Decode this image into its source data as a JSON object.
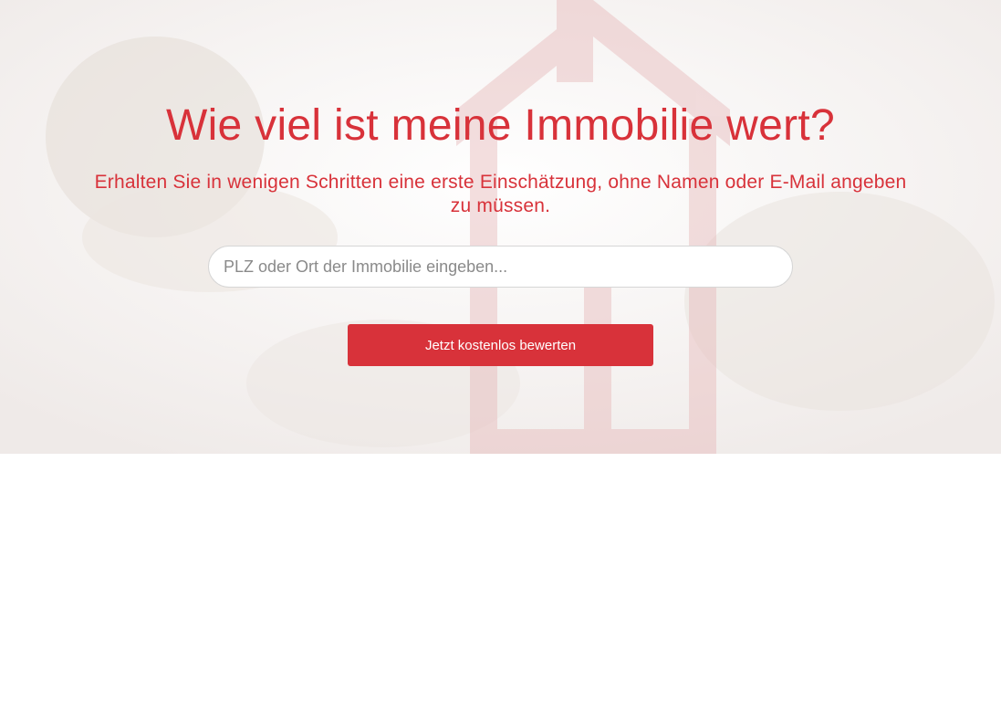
{
  "hero": {
    "headline": "Wie viel ist meine Immobilie wert?",
    "subline": "Erhalten Sie in wenigen Schritten eine erste Einschätzung, ohne Namen oder E-Mail angeben zu müssen.",
    "background_image": "house-key-hand-photo",
    "accent_color": "#d8323a"
  },
  "search": {
    "value": "",
    "placeholder": "PLZ oder Ort der Immobilie eingeben..."
  },
  "cta": {
    "label": "Jetzt kostenlos bewerten"
  }
}
